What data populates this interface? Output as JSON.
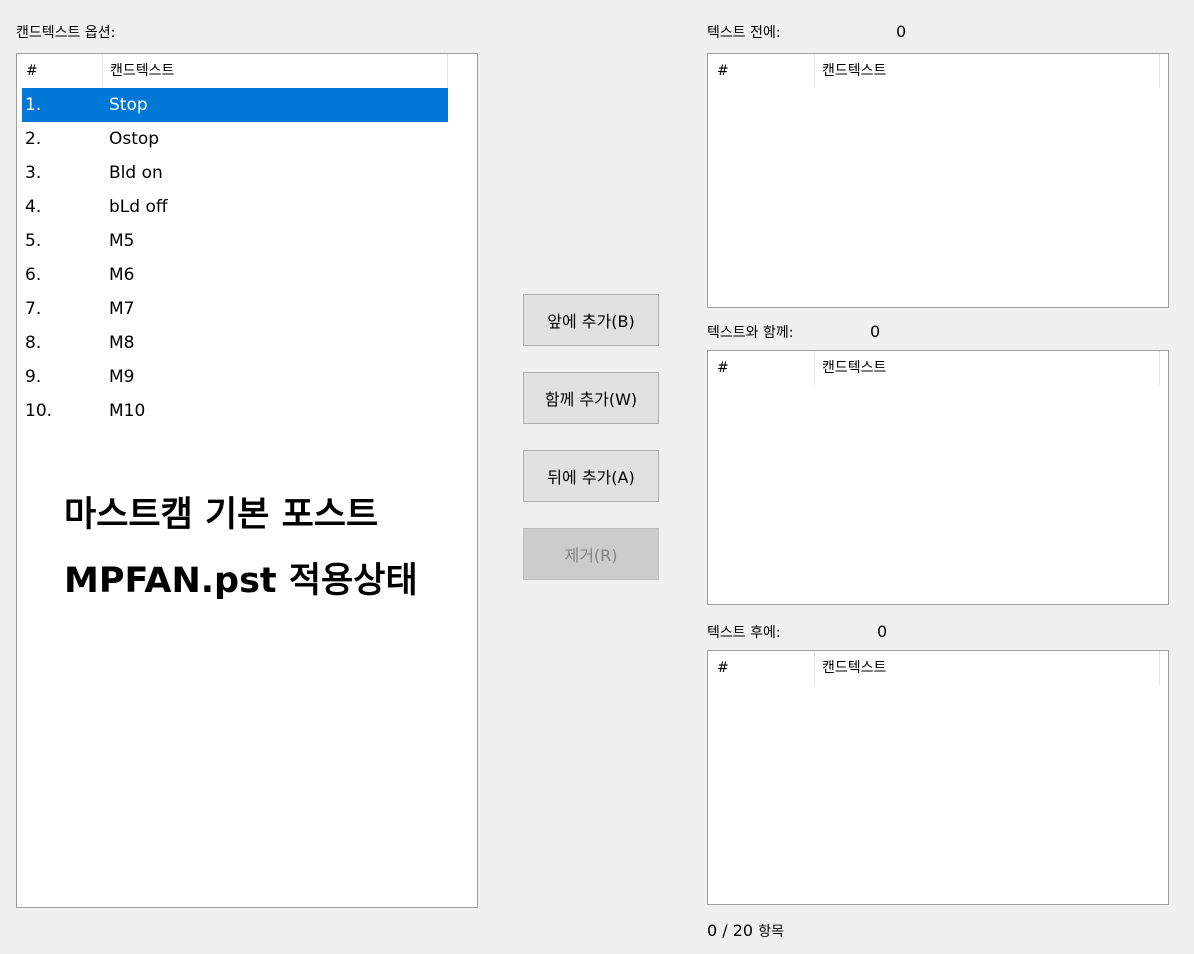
{
  "options_label": "캔드텍스트 옵션:",
  "options_list": {
    "header_num": "#",
    "header_text": "캔드텍스트",
    "rows": [
      {
        "num": "1.",
        "text": "Stop",
        "selected": true
      },
      {
        "num": "2.",
        "text": "Ostop"
      },
      {
        "num": "3.",
        "text": "Bld on"
      },
      {
        "num": "4.",
        "text": "bLd off"
      },
      {
        "num": "5.",
        "text": "M5"
      },
      {
        "num": "6.",
        "text": "M6"
      },
      {
        "num": "7.",
        "text": "M7"
      },
      {
        "num": "8.",
        "text": "M8"
      },
      {
        "num": "9.",
        "text": "M9"
      },
      {
        "num": "10.",
        "text": "M10"
      }
    ]
  },
  "overlay_text": {
    "line1": "마스트캠 기본 포스트",
    "line2": "MPFAN.pst 적용상태"
  },
  "buttons": {
    "add_before": "앞에 추가(B)",
    "add_with": "함께 추가(W)",
    "add_after": "뒤에 추가(A)",
    "remove": "제거(R)"
  },
  "before": {
    "label": "텍스트 전에:",
    "count": "0",
    "header_num": "#",
    "header_text": "캔드텍스트"
  },
  "with": {
    "label": "텍스트와 함께:",
    "count": "0",
    "header_num": "#",
    "header_text": "캔드텍스트"
  },
  "after": {
    "label": "텍스트 후에:",
    "count": "0",
    "header_num": "#",
    "header_text": "캔드텍스트"
  },
  "footer": {
    "count": "0 / 20",
    "unit": "항목"
  },
  "colors": {
    "selection": "#0078d7",
    "background": "#f0f0f0"
  }
}
